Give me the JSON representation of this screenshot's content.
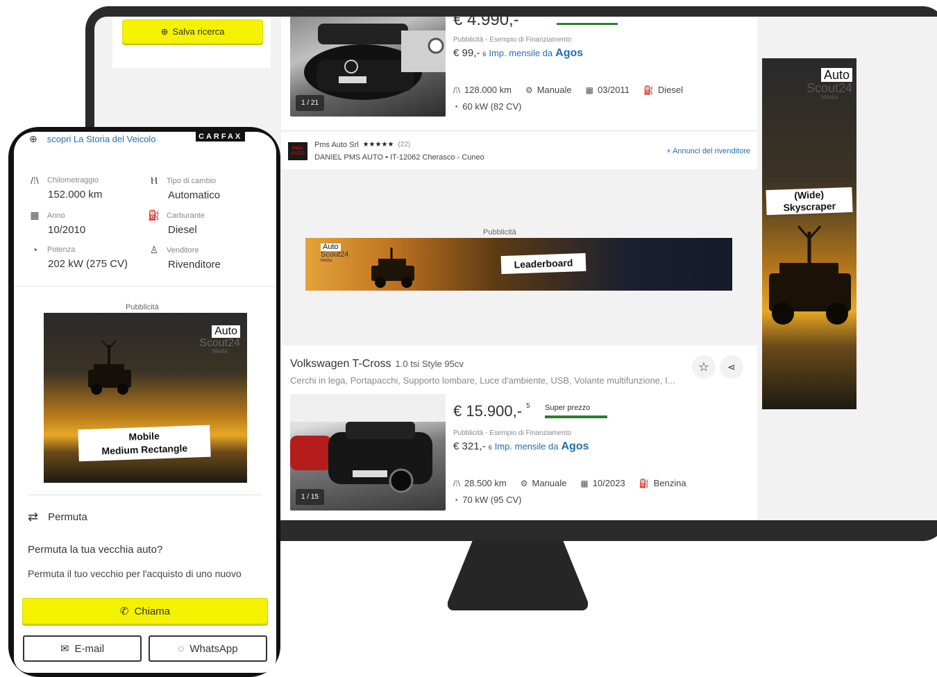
{
  "desktop": {
    "save_search_label": "Salva ricerca",
    "listing1": {
      "price": "€ 4.990,-",
      "fin_label": "Pubblicità - Esempio di Finanziamento",
      "monthly": "€ 99,-",
      "monthly_sup": "6",
      "monthly_text": "Imp. mensile da",
      "agos": "Agos",
      "img_counter": "1 / 21",
      "mileage": "128.000 km",
      "gearbox": "Manuale",
      "date": "03/2011",
      "fuel": "Diesel",
      "power": "60 kW (82 CV)"
    },
    "dealer": {
      "name": "Pms Auto Srl",
      "stars": "★★★★★",
      "reviews": "(22)",
      "address": "DANIEL PMS AUTO • IT-12062 Cherasco - Cuneo",
      "link": "+ Annunci del rivenditore",
      "logo": "PMS AUTO"
    },
    "ad_label": "Pubblicità",
    "leaderboard": {
      "text": "Leaderboard",
      "brand1": "Auto",
      "brand2": "Scout24",
      "brand3": "Media"
    },
    "skyscraper": {
      "text1": "(Wide)",
      "text2": "Skyscraper",
      "brand1": "Auto",
      "brand2": "Scout24",
      "brand3": "Media"
    },
    "listing2": {
      "make_model": "Volkswagen T-Cross",
      "version": "1.0 tsi Style 95cv",
      "features": "Cerchi in lega, Portapacchi, Supporto lombare, Luce d'ambiente, USB, Volante multifunzione, I...",
      "price": "€ 15.900,-",
      "price_sup": "5",
      "badge": "Super prezzo",
      "fin_label": "Pubblicità - Esempio di Finanziamento",
      "monthly": "€ 321,-",
      "monthly_sup": "6",
      "monthly_text": "Imp. mensile da",
      "agos": "Agos",
      "img_counter": "1 / 15",
      "mileage": "28.500 km",
      "gearbox": "Manuale",
      "date": "10/2023",
      "fuel": "Benzina",
      "power": "70 kW (95 CV)"
    }
  },
  "phone": {
    "history_link": "scopri La Storia del Veicolo",
    "carfax": "CARFAX",
    "specs": [
      {
        "label": "Chilometraggio",
        "value": "152.000 km"
      },
      {
        "label": "Tipo di cambio",
        "value": "Automatico"
      },
      {
        "label": "Anno",
        "value": "10/2010"
      },
      {
        "label": "Carburante",
        "value": "Diesel"
      },
      {
        "label": "Potenza",
        "value": "202 kW (275 CV)"
      },
      {
        "label": "Venditore",
        "value": "Rivenditore"
      }
    ],
    "ad_label": "Pubblicità",
    "ad": {
      "line1": "Mobile",
      "line2": "Medium Rectangle",
      "brand1": "Auto",
      "brand2": "Scout24",
      "brand3": "Media"
    },
    "trade_in_title": "Permuta",
    "trade_in_question": "Permuta la tua vecchia auto?",
    "trade_in_text": "Permuta il tuo vecchio per l'acquisto di uno nuovo",
    "call_label": "Chiama",
    "email_label": "E-mail",
    "whatsapp_label": "WhatsApp"
  },
  "colors": {
    "accent_yellow": "#f5f200",
    "link_blue": "#1f6fb2",
    "badge_green": "#2e7d32"
  }
}
